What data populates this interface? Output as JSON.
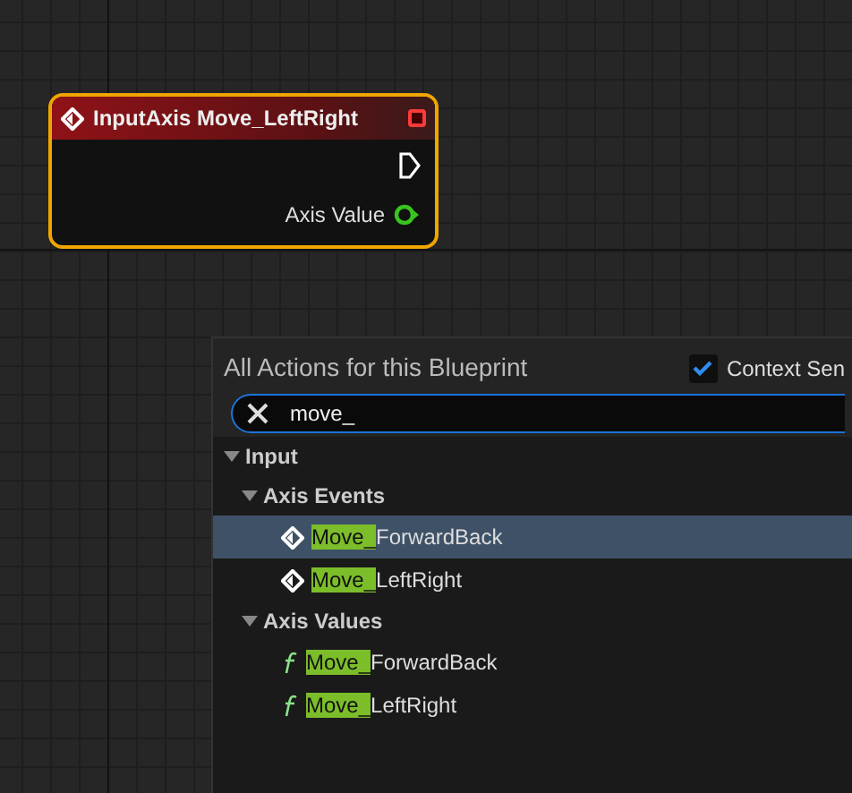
{
  "node": {
    "title": "InputAxis Move_LeftRight",
    "pins": [
      {
        "kind": "exec"
      },
      {
        "kind": "float",
        "label": "Axis Value"
      }
    ]
  },
  "action_menu": {
    "title": "All Actions for this Blueprint",
    "context_sensitive": {
      "label": "Context Sen",
      "checked": true
    },
    "search": {
      "value": "move_"
    },
    "tree": [
      {
        "label": "Input",
        "expanded": true,
        "children": [
          {
            "label": "Axis Events",
            "expanded": true,
            "children": [
              {
                "kind": "event",
                "match": "Move_",
                "rest": "ForwardBack",
                "selected": true
              },
              {
                "kind": "event",
                "match": "Move_",
                "rest": "LeftRight",
                "selected": false
              }
            ]
          },
          {
            "label": "Axis Values",
            "expanded": true,
            "children": [
              {
                "kind": "function",
                "match": "Move_",
                "rest": "ForwardBack",
                "selected": false
              },
              {
                "kind": "function",
                "match": "Move_",
                "rest": "LeftRight",
                "selected": false
              }
            ]
          }
        ]
      }
    ]
  }
}
